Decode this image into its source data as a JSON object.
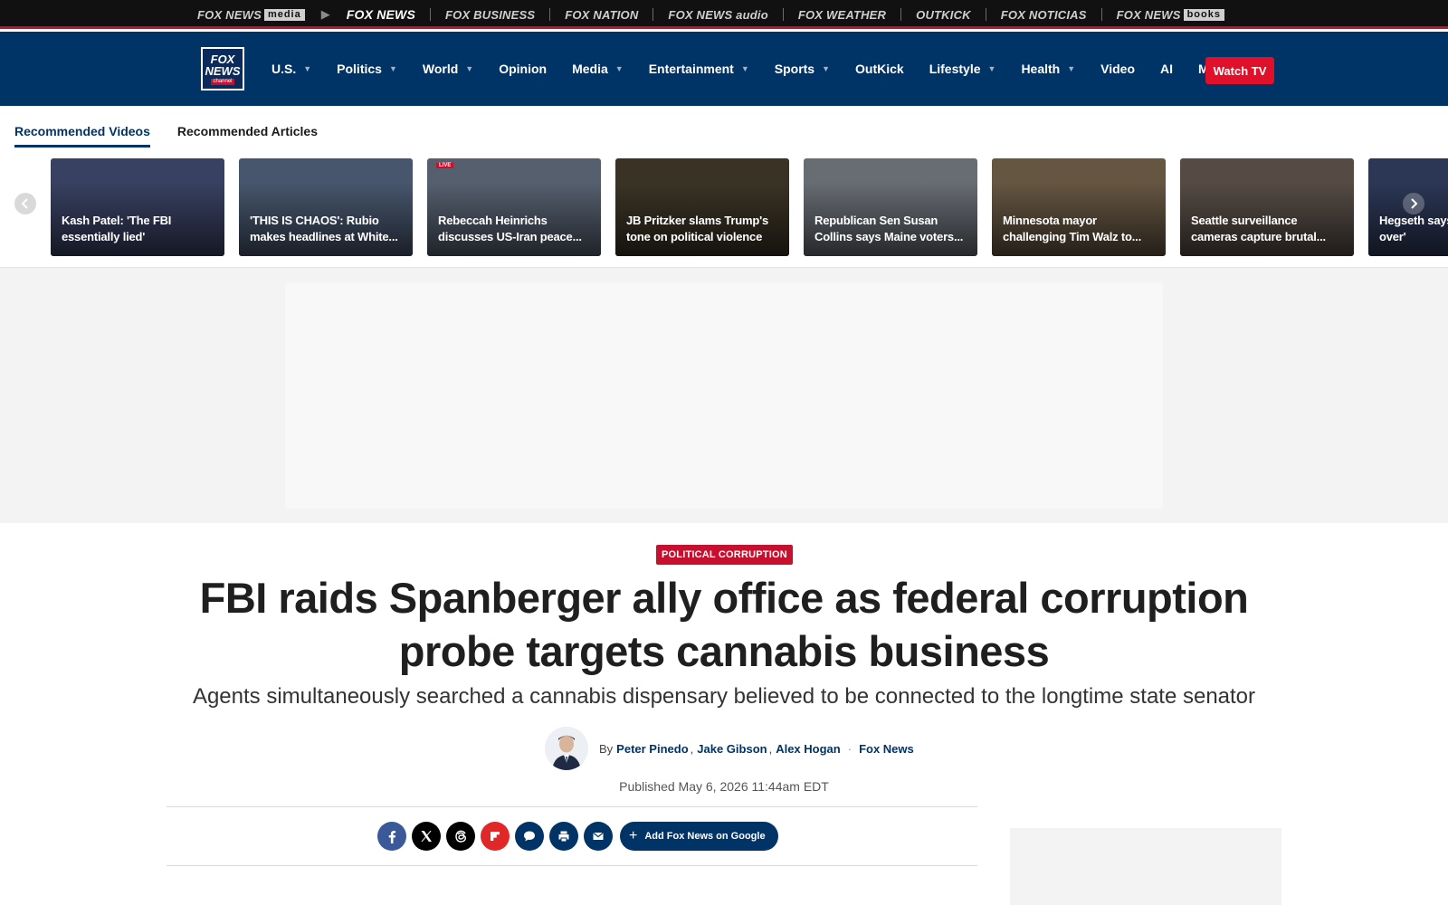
{
  "network_bar": {
    "items": [
      {
        "label": "FOX NEWS",
        "box": "media"
      },
      {
        "label": "FOX NEWS"
      },
      {
        "label": "FOX BUSINESS"
      },
      {
        "label": "FOX NATION"
      },
      {
        "label": "FOX NEWS audio"
      },
      {
        "label": "FOX WEATHER"
      },
      {
        "label": "OUTKICK"
      },
      {
        "label": "FOX NOTICIAS"
      },
      {
        "label": "FOX NEWS",
        "box": "books"
      }
    ]
  },
  "logo": {
    "line1": "FOX",
    "line2": "NEWS",
    "channel": "channel"
  },
  "nav": {
    "items": [
      {
        "label": "U.S.",
        "caret": true
      },
      {
        "label": "Politics",
        "caret": true
      },
      {
        "label": "World",
        "caret": true
      },
      {
        "label": "Opinion",
        "caret": false
      },
      {
        "label": "Media",
        "caret": true
      },
      {
        "label": "Entertainment",
        "caret": true
      },
      {
        "label": "Sports",
        "caret": true
      },
      {
        "label": "OutKick",
        "caret": false
      },
      {
        "label": "Lifestyle",
        "caret": true
      },
      {
        "label": "Health",
        "caret": true
      },
      {
        "label": "Video",
        "caret": false
      },
      {
        "label": "AI",
        "caret": false
      },
      {
        "label": "More",
        "caret": false
      }
    ],
    "watch_tv": "Watch TV"
  },
  "recommended": {
    "tabs": [
      "Recommended Videos",
      "Recommended Articles"
    ],
    "videos": [
      {
        "title": "Kash Patel: 'The FBI essentially lied'",
        "color": "#3b4466"
      },
      {
        "title": "'THIS IS CHAOS': Rubio makes headlines at White...",
        "color": "#4b5a72"
      },
      {
        "title": "Rebeccah Heinrichs discusses US-Iran peace...",
        "color": "#5a6474",
        "live": "LIVE"
      },
      {
        "title": "JB Pritzker slams Trump's tone on political violence",
        "color": "#3d3527"
      },
      {
        "title": "Republican Sen Susan Collins says Maine voters...",
        "color": "#6d7279"
      },
      {
        "title": "Minnesota mayor challenging Tim Walz to...",
        "color": "#6a5a45"
      },
      {
        "title": "Seattle surveillance cameras capture brutal...",
        "color": "#5a4f48"
      },
      {
        "title": "Hegseth says ceasefire 'not over'",
        "color": "#2e3a5a"
      }
    ]
  },
  "article": {
    "eyebrow": "POLITICAL CORRUPTION",
    "headline": "FBI raids Spanberger ally office as federal corruption probe targets cannabis business",
    "subhead": "Agents simultaneously searched a cannabis dispensary believed to be connected to the longtime state senator",
    "by": "By",
    "authors": [
      "Peter Pinedo",
      "Jake Gibson",
      "Alex Hogan"
    ],
    "outlet": "Fox News",
    "published": "Published May 6, 2026 11:44am EDT"
  },
  "share": {
    "buttons": [
      {
        "icon": "facebook-icon",
        "color": "#3b5998"
      },
      {
        "icon": "x-icon",
        "color": "#000000"
      },
      {
        "icon": "threads-icon",
        "color": "#000000"
      },
      {
        "icon": "flipboard-icon",
        "color": "#e12828"
      },
      {
        "icon": "comment-icon",
        "color": "#003366"
      },
      {
        "icon": "print-icon",
        "color": "#003366"
      },
      {
        "icon": "email-icon",
        "color": "#003366"
      }
    ],
    "add_google": "Add Fox News on Google"
  }
}
